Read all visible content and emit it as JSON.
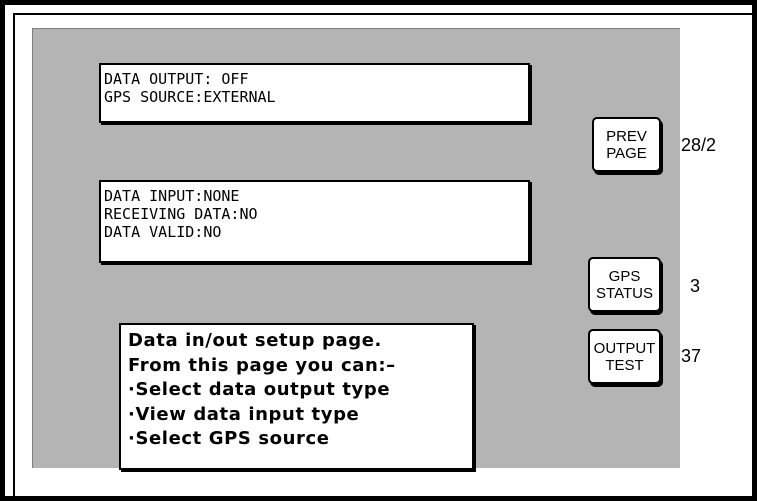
{
  "output_panel": {
    "lines": [
      "DATA OUTPUT: OFF",
      "GPS SOURCE:EXTERNAL"
    ]
  },
  "input_panel": {
    "lines": [
      "DATA INPUT:NONE",
      "RECEIVING DATA:NO",
      "DATA VALID:NO"
    ]
  },
  "help_panel": {
    "lines": [
      "Data in/out setup page.",
      "From this page you can:–",
      "·Select data output type",
      "·View data input type",
      "·Select GPS source"
    ]
  },
  "buttons": {
    "prev_page": {
      "line1": "PREV",
      "line2": "PAGE",
      "ref": "28/2"
    },
    "gps_status": {
      "line1": "GPS",
      "line2": "STATUS",
      "ref": "3"
    },
    "output_test": {
      "line1": "OUTPUT",
      "line2": "TEST",
      "ref": "37"
    }
  }
}
